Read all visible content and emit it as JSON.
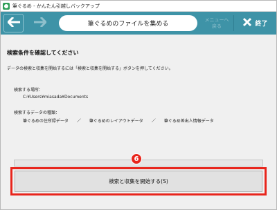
{
  "window": {
    "title": "筆ぐるめ - かんたん引越しバックアップ"
  },
  "toolbar": {
    "back_icon": "arrow-left-icon",
    "forward_icon": "arrow-right-icon",
    "page_title": "筆ぐるめのファイルを集める",
    "menu_label_1": "メニューへ",
    "menu_label_2": "戻る",
    "exit_label": "終了",
    "exit_icon": "close-icon",
    "accent_color": "#3e93a7"
  },
  "main": {
    "heading": "検索条件を確認してください",
    "description": "データの検索と収集を開始するには「検索と収集を開始する」ボタンを押してください。",
    "location_label": "検索する場所：",
    "location_value": "C:¥Users¥miasada¥Documents",
    "types_label": "検索するデータの種類：",
    "types": [
      "筆ぐるめの住所録データ",
      "筆ぐるめのレイアウトデータ",
      "筆ぐるめ差出人情報データ"
    ],
    "types_separator": "／",
    "progress": 0,
    "step_badge": "6",
    "start_button_label": "検索と収集を開始する(S)",
    "highlight_color": "#e8251c"
  }
}
